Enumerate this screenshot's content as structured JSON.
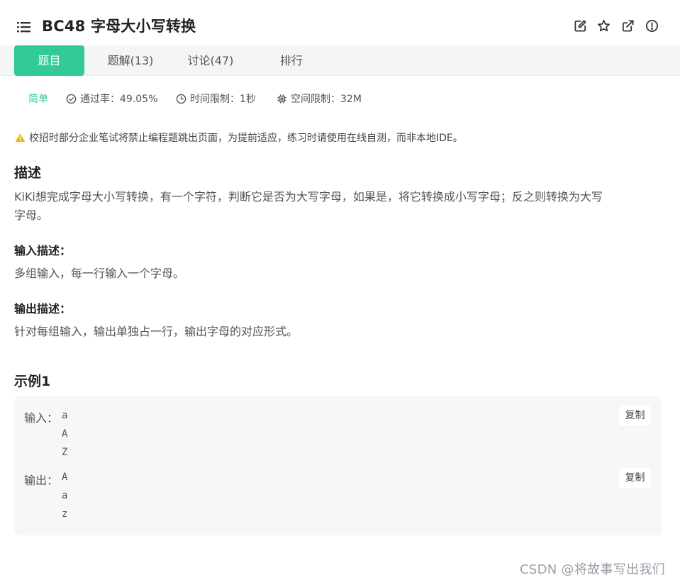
{
  "header": {
    "title": "BC48  字母大小写转换",
    "icons": [
      "menu-list-icon",
      "edit-icon",
      "star-icon",
      "external-link-icon",
      "alert-circle-icon"
    ]
  },
  "tabs": [
    {
      "label": "题目",
      "active": true
    },
    {
      "label": "题解(13)",
      "active": false
    },
    {
      "label": "讨论(47)",
      "active": false
    },
    {
      "label": "排行",
      "active": false
    }
  ],
  "meta": {
    "level": "简单",
    "pass_rate": "通过率：49.05%",
    "time_limit": "时间限制：1秒",
    "space_limit": "空间限制：32M"
  },
  "notice": "校招时部分企业笔试将禁止编程题跳出页面，为提前适应，练习时请使用在线自测，而非本地IDE。",
  "description": {
    "heading": "描述",
    "line1": "KiKi想完成字母大小写转换，有一个字符，判断它是否为大写字母，如果是，将它转换成小写字母；反之则转换为大写",
    "line2": "字母。"
  },
  "input_desc": {
    "heading": "输入描述：",
    "text": "多组输入，每一行输入一个字母。"
  },
  "output_desc": {
    "heading": "输出描述：",
    "text": "针对每组输入，输出单独占一行，输出字母的对应形式。"
  },
  "example": {
    "heading": "示例1",
    "input_label": "输入：",
    "input_lines": [
      "a",
      "A",
      "Z"
    ],
    "output_label": "输出：",
    "output_lines": [
      "A",
      "a",
      "z"
    ],
    "copy_label": "复制"
  },
  "watermark": "CSDN @将故事写出我们",
  "colors": {
    "accent": "#32ca99",
    "warning": "#f5b400",
    "tab_bar_bg": "#f4f5f7",
    "example_bg": "#f6f7f9"
  }
}
